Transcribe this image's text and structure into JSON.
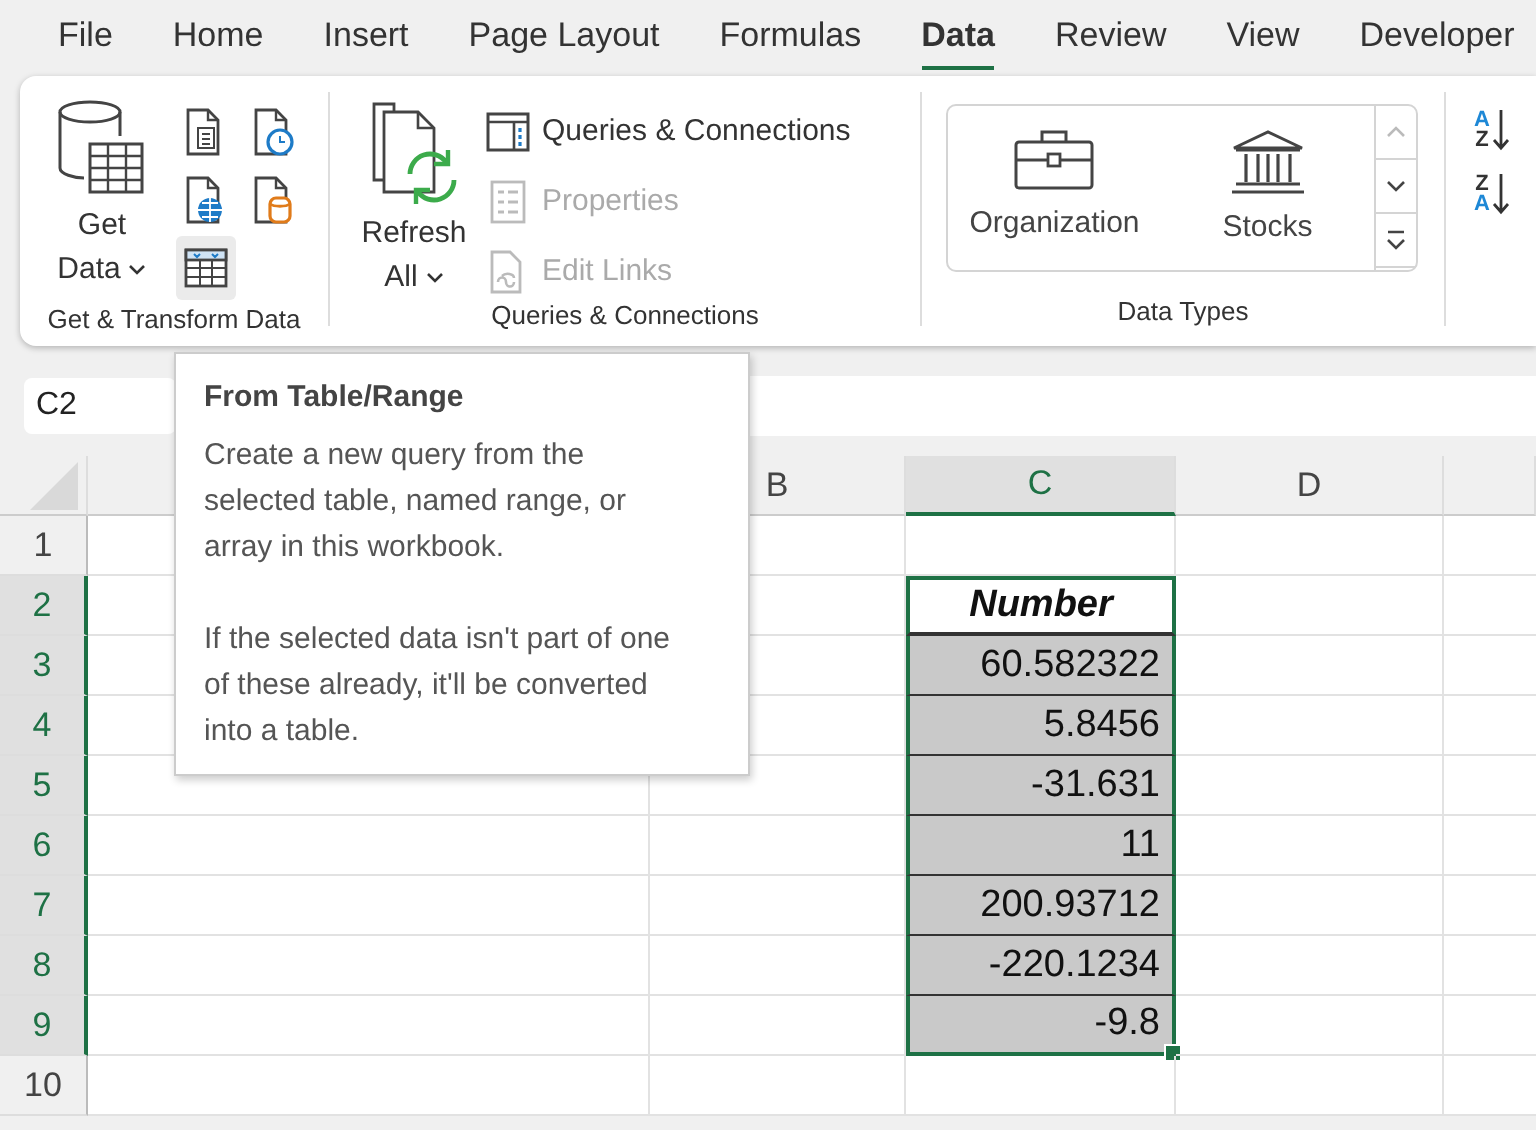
{
  "tabs": [
    {
      "label": "File",
      "selected": false
    },
    {
      "label": "Home",
      "selected": false
    },
    {
      "label": "Insert",
      "selected": false
    },
    {
      "label": "Page Layout",
      "selected": false
    },
    {
      "label": "Formulas",
      "selected": false
    },
    {
      "label": "Data",
      "selected": true
    },
    {
      "label": "Review",
      "selected": false
    },
    {
      "label": "View",
      "selected": false
    },
    {
      "label": "Developer",
      "selected": false
    }
  ],
  "get_transform": {
    "label": "Get & Transform Data",
    "get_data": {
      "label": "Get Data"
    },
    "tools": [
      {
        "kind": "text-file",
        "hovered": false
      },
      {
        "kind": "clock-file",
        "hovered": false
      },
      {
        "kind": "web-file",
        "hovered": false
      },
      {
        "kind": "database-file",
        "hovered": false
      },
      {
        "kind": "table",
        "hovered": true
      }
    ]
  },
  "queries": {
    "label": "Queries & Connections",
    "refresh": {
      "label": "Refresh All"
    },
    "items": [
      {
        "kind": "panel",
        "label": "Queries & Connections",
        "disabled": false
      },
      {
        "kind": "properties",
        "label": "Properties",
        "disabled": true
      },
      {
        "kind": "links",
        "label": "Edit Links",
        "disabled": true
      }
    ]
  },
  "data_types": {
    "label": "Data Types",
    "items": [
      {
        "kind": "organization",
        "label": "Organization"
      },
      {
        "kind": "stocks",
        "label": "Stocks"
      }
    ]
  },
  "sort": [
    {
      "kind": "ascending",
      "top": "A",
      "bottom": "Z"
    },
    {
      "kind": "descending",
      "top": "Z",
      "bottom": "A"
    }
  ],
  "name_box": "C2",
  "tooltip": {
    "title": "From Table/Range",
    "paragraphs": [
      "Create a new query from the selected table, named range, or array in this workbook.",
      "If the selected data isn't part of one of these already, it'll be converted into a table."
    ]
  },
  "columns": [
    {
      "label": "B",
      "selected": false
    },
    {
      "label": "C",
      "selected": true
    },
    {
      "label": "D",
      "selected": false
    }
  ],
  "rows": [
    {
      "number": "1",
      "selected": false
    },
    {
      "number": "2",
      "selected": true,
      "kind": "header",
      "value": "Number"
    },
    {
      "number": "3",
      "selected": true,
      "kind": "data",
      "value": "60.582322"
    },
    {
      "number": "4",
      "selected": true,
      "kind": "data",
      "value": "5.8456"
    },
    {
      "number": "5",
      "selected": true,
      "kind": "data",
      "value": "-31.631"
    },
    {
      "number": "6",
      "selected": true,
      "kind": "data",
      "value": "11"
    },
    {
      "number": "7",
      "selected": true,
      "kind": "data",
      "value": "200.93712"
    },
    {
      "number": "8",
      "selected": true,
      "kind": "data",
      "value": "-220.1234"
    },
    {
      "number": "9",
      "selected": true,
      "kind": "data",
      "value": "-9.8"
    },
    {
      "number": "10",
      "selected": false
    }
  ]
}
